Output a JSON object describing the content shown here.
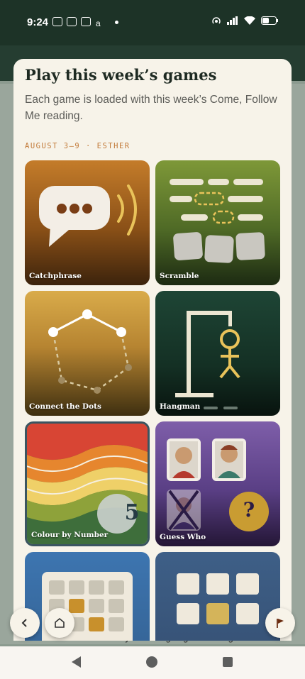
{
  "status": {
    "time": "9:24"
  },
  "modal": {
    "title": "Play this week’s games",
    "subtitle": "Each game is loaded with this week’s Come, Follow Me reading.",
    "week_label": "AUGUST 3–9 · ESTHER"
  },
  "games": [
    {
      "label": "Catchphrase",
      "icon": "speech-bubble-icon"
    },
    {
      "label": "Scramble",
      "icon": "scramble-tiles-icon"
    },
    {
      "label": "Connect the Dots",
      "icon": "dots-icon"
    },
    {
      "label": "Hangman",
      "icon": "hangman-icon"
    },
    {
      "label": "Colour by Number",
      "icon": "colour-waves-icon",
      "number": "5"
    },
    {
      "label": "Guess Who",
      "icon": "portrait-cards-icon",
      "mark": "?"
    }
  ],
  "background_text": "6. Esther fasts three days before going to the king.",
  "buttons": {
    "back": "back-icon",
    "home": "home-icon",
    "flag": "flag-icon"
  }
}
